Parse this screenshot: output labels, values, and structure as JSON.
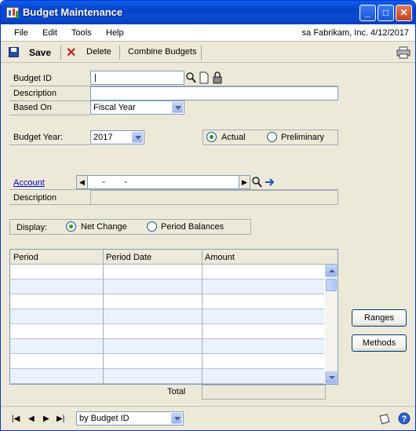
{
  "window": {
    "title": "Budget Maintenance"
  },
  "menu": {
    "items": [
      "File",
      "Edit",
      "Tools",
      "Help"
    ],
    "user_info": "sa  Fabrikam, Inc.  4/12/2017"
  },
  "toolbar": {
    "save_label": "Save",
    "delete_label": "Delete",
    "combine_label": "Combine Budgets"
  },
  "form": {
    "budget_id_label": "Budget ID",
    "budget_id_value": "|",
    "description_label": "Description",
    "based_on_label": "Based On",
    "based_on_value": "Fiscal Year",
    "budget_year_label": "Budget Year:",
    "budget_year_value": "2017",
    "actual_label": "Actual",
    "preliminary_label": "Preliminary",
    "account_label": "Account",
    "account_mask": "    -        -",
    "account_description_label": "Description",
    "display_label": "Display:",
    "net_change_label": "Net Change",
    "period_balances_label": "Period Balances"
  },
  "grid": {
    "columns": [
      "Period",
      "Period Date",
      "Amount"
    ],
    "row_count": 8,
    "total_label": "Total"
  },
  "buttons": {
    "ranges_label": "Ranges",
    "methods_label": "Methods"
  },
  "footer": {
    "sort_value": "by Budget ID"
  },
  "colors": {
    "title_bar": "#0a4bd5",
    "window_bg": "#ece9d8",
    "accent_green": "#21a121",
    "link": "#0000cc"
  }
}
